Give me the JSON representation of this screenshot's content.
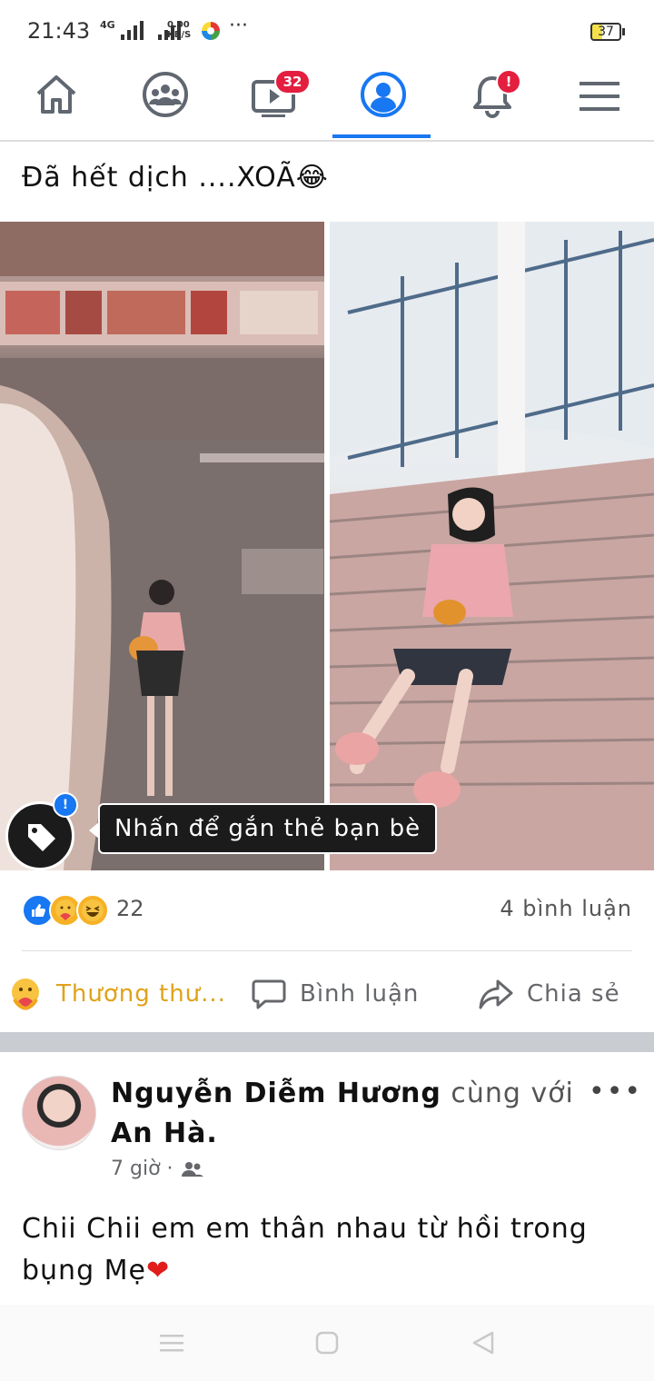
{
  "status": {
    "time": "21:43",
    "network": "4G",
    "speed_value": "0.00",
    "speed_unit": "KB/S",
    "more": "···",
    "battery": "37"
  },
  "nav": {
    "tabs": [
      {
        "icon": "home-icon"
      },
      {
        "icon": "groups-icon"
      },
      {
        "icon": "watch-icon",
        "badge": "32"
      },
      {
        "icon": "profile-icon",
        "active": true
      },
      {
        "icon": "notifications-icon",
        "badge": "!"
      },
      {
        "icon": "menu-icon"
      }
    ]
  },
  "post1": {
    "text": "Đã hết dịch ....XOÃ😂",
    "photo_left_alt": "",
    "tag_badge": "!",
    "tag_tooltip": "Nhấn để gắn thẻ bạn bè",
    "reaction_count": "22",
    "comment_count": "4 bình luận",
    "actions": {
      "care": "Thương thư...",
      "comment": "Bình luận",
      "share": "Chia sẻ"
    }
  },
  "post2": {
    "author": "Nguyễn Diễm Hương",
    "with_text": "cùng với",
    "tagged": "An Hà.",
    "time": "7 giờ ·",
    "more": "•••",
    "text": "Chii Chii em em thân nhau từ hồi trong bụng Mẹ",
    "emoji": "❤"
  },
  "colors": {
    "accent": "#1877f2",
    "badge": "#e41e3f",
    "care": "#e0a21a"
  }
}
